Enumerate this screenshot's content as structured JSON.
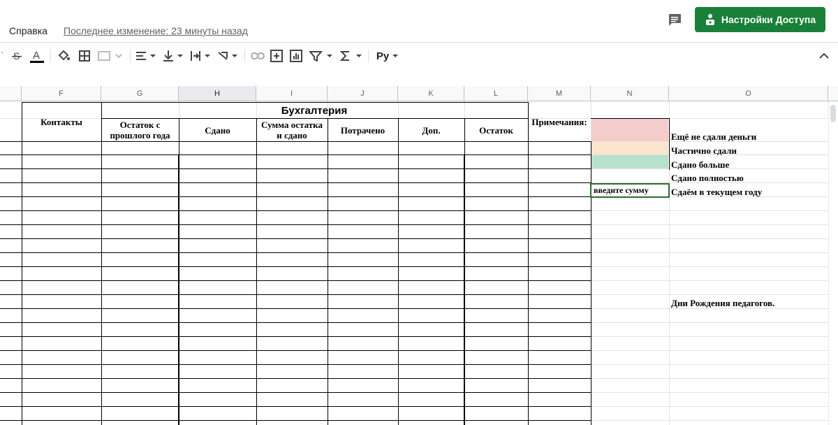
{
  "menu": {
    "help_label": "Справка",
    "last_edit": "Последнее изменение: 23 минуты назад"
  },
  "header": {
    "share_label": "Настройки Доступа",
    "share_color": "#188038"
  },
  "toolbar": {
    "icons": [
      "strikethrough-icon",
      "text-color-icon",
      "fill-color-icon",
      "borders-icon",
      "merge-cells-icon",
      "align-horizontal-icon",
      "align-vertical-icon",
      "text-wrap-icon",
      "text-rotate-icon",
      "insert-link-icon",
      "insert-comment-icon",
      "insert-chart-icon",
      "filter-icon",
      "functions-icon",
      "input-tools-icon"
    ],
    "input_tools_label": "Pу"
  },
  "columns": [
    "F",
    "G",
    "H",
    "I",
    "J",
    "K",
    "L",
    "M",
    "N",
    "O"
  ],
  "sheet": {
    "title": "Бухгалтерия",
    "headers": {
      "contacts": "Контакты",
      "balance_prev_line1": "Остаток с",
      "balance_prev_line2": "прошлого года",
      "submitted": "Сдано",
      "sum_line1": "Сумма остатка",
      "sum_line2": "и сдано",
      "spent": "Потрачено",
      "extra": "Доп.",
      "balance": "Остаток",
      "notes": "Примечания:"
    },
    "legend": [
      {
        "label": "Ещё не сдали деньги",
        "color": "#f4cccc"
      },
      {
        "label": "Частично сдали",
        "color": "#fce5cd"
      },
      {
        "label": "Сдано больше",
        "color": "#b7e1cd"
      },
      {
        "label": "Сдано полностью",
        "color": "#ffffff"
      },
      {
        "label": "Сдаём в текущем году",
        "color": "#ffffff"
      }
    ],
    "input_cell_text": "введите сумму",
    "birthdays_label": "Дни Рождения педагогов."
  }
}
